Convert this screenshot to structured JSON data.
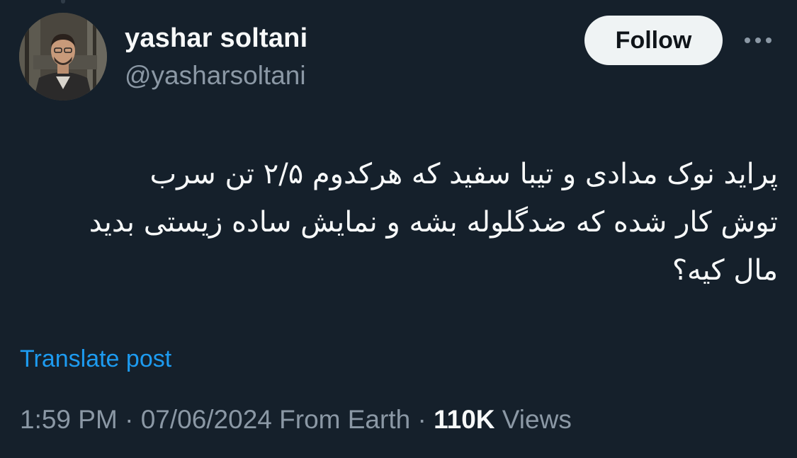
{
  "author": {
    "display_name": "yashar soltani",
    "handle": "@yasharsoltani"
  },
  "actions": {
    "follow_label": "Follow",
    "more_icon": "more-horizontal-icon"
  },
  "post": {
    "text": "پراید نوک مدادی و تیبا سفید که هرکدوم ۲/۵ تن سرب\nتوش کار شده که ضدگلوله بشه و نمایش ساده زیستی بدید\nمال کیه؟",
    "translate_label": "Translate post"
  },
  "meta": {
    "time": "1:59 PM",
    "sep1": " · ",
    "date": "07/06/2024",
    "location": " From Earth",
    "sep2": " · ",
    "views_count": "110K",
    "views_label": " Views"
  },
  "colors": {
    "background": "#15202b",
    "primary_text": "#f7f9f9",
    "secondary_text": "#8b98a5",
    "link": "#1d9bf0",
    "follow_bg": "#eff3f4"
  }
}
